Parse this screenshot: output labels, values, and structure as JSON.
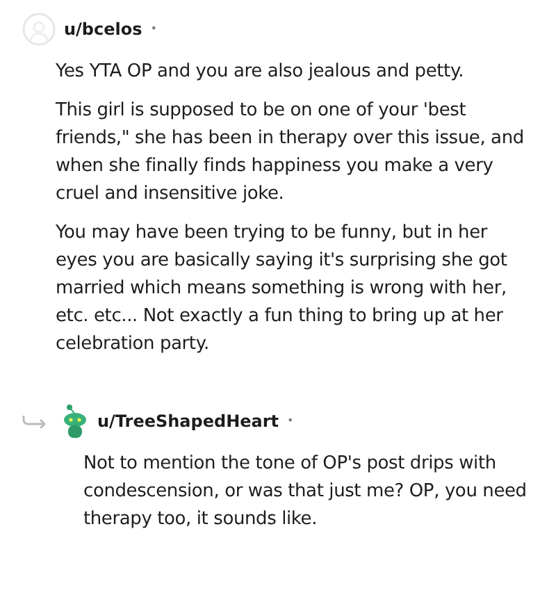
{
  "comments": [
    {
      "avatar": {
        "kind": "outline"
      },
      "username": "u/bcelos",
      "separator": "•",
      "is_reply": false,
      "paragraphs": [
        "Yes YTA OP and you are also jealous and petty.",
        "This girl is supposed to be on one of your 'best friends,\" she has been in therapy over this issue, and when she finally finds happiness you make a very cruel and insensitive joke.",
        "You may have been trying to be funny, but in her eyes you are basically saying it's surprising she got married which means something is wrong with her, etc. etc... Not exactly a fun thing to bring up at her celebration party."
      ]
    },
    {
      "avatar": {
        "kind": "robot"
      },
      "username": "u/TreeShapedHeart",
      "separator": "•",
      "is_reply": true,
      "paragraphs": [
        "Not to mention the tone of OP's post drips with condescension, or was that just me? OP, you need therapy too, it sounds like."
      ]
    }
  ]
}
